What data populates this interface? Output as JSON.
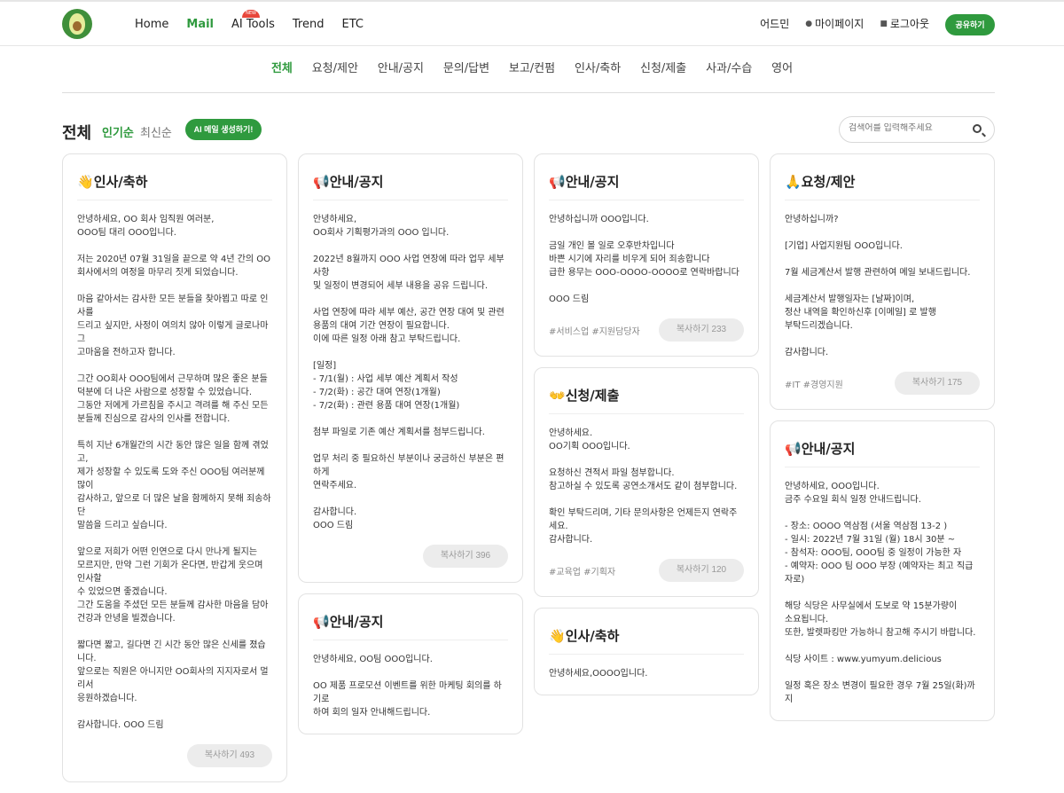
{
  "nav": {
    "items": [
      "Home",
      "Mail",
      "AI Tools",
      "Trend",
      "ETC"
    ],
    "active": "Mail",
    "badge": "NEW"
  },
  "user_nav": {
    "admin": "어드민",
    "mypage": "마이페이지",
    "logout": "로그아웃",
    "share": "공유하기"
  },
  "categories": [
    "전체",
    "요청/제안",
    "안내/공지",
    "문의/답변",
    "보고/컨펌",
    "인사/축하",
    "신청/제출",
    "사과/수습",
    "영어"
  ],
  "page": {
    "title": "전체",
    "sort_popular": "인기순",
    "sort_recent": "최신순",
    "ai_button": "AI 메일 생성하기!",
    "search_placeholder": "검색어를 입력해주세요"
  },
  "columns": [
    [
      {
        "emoji": "👋",
        "title": "인사/축하",
        "body": "안녕하세요, OO 회사 임직원 여러분,\nOOO팀 대리 OOO입니다.\n\n저는 2020년 07월 31일을 끝으로 약 4년 간의 OO\n회사에서의 여정을 마무리 짓게 되었습니다.\n\n마음 같아서는 감사한 모든 분들을 찾아뵙고 따로 인사를\n드리고 싶지만, 사정이 여의치 않아 이렇게 글로나마 그\n고마움을 전하고자 합니다.\n\n그간 OO회사 OOO팀에서 근무하며 많은 좋은 분들\n덕분에 더 나은 사람으로 성장할 수 있었습니다.\n그동안 저에게 가르침을 주시고 격려를 해 주신 모든\n분들께 진심으로 감사의 인사를 전합니다.\n\n특히 지난 6개월간의 시간 동안 많은 일을 함께 겪었고,\n제가 성장할 수 있도록 도와 주신 OOO팀 여러분께 많이\n감사하고, 앞으로 더 많은 날을 함께하지 못해 죄송하단\n말씀을 드리고 싶습니다.\n\n앞으로 저희가 어떤 인연으로 다시 만나게 될지는\n모르지만, 만약 그런 기회가 온다면, 반갑게 웃으며 인사할\n수 있었으면 좋겠습니다.\n그간 도움을 주셨던 모든 분들께 감사한 마음을 담아\n건강과 안녕을 빌겠습니다.\n\n짧다면 짧고, 길다면 긴 시간 동안 많은 신세를 졌습니다.\n앞으로는 직원은 아니지만 OO회사의 지지자로서 멀리서\n응원하겠습니다.\n\n감사합니다. OOO 드림",
        "tags": "",
        "copy": "복사하기 493"
      }
    ],
    [
      {
        "emoji": "📢",
        "title": "안내/공지",
        "body": "안녕하세요,\nOO회사 기획평가과의 OOO 입니다.\n\n2022년 8월까지 OOO 사업 연장에 따라 업무 세부 사항\n및 일정이 변경되어 세부 내용을 공유 드립니다.\n\n사업 연장에 따라 세부 예산, 공간 연장 대여 및 관련\n용품의 대여 기간 연장이 필요합니다.\n이에 따른 일정 아래 참고 부탁드립니다.\n\n[일정]\n- 7/1(월) : 사업 세부 예산 계획서 작성\n- 7/2(화) : 공간 대여 연장(1개월)\n- 7/2(화) : 관련 용품 대여 연장(1개월)\n\n첨부 파일로 기존 예산 계획서를 첨부드립니다.\n\n업무 처리 중 필요하신 부분이나 궁금하신 부분은 편하게\n연락주세요.\n\n감사합니다.\nOOO 드림",
        "tags": "",
        "copy": "복사하기 396"
      },
      {
        "emoji": "📢",
        "title": "안내/공지",
        "body": "안녕하세요, OO팀 OOO입니다.\n\nOO 제품 프로모션 이벤트를 위한 마케팅 회의를 하기로\n하여 회의 일자 안내해드립니다.",
        "tags": "",
        "copy": ""
      }
    ],
    [
      {
        "emoji": "📢",
        "title": "안내/공지",
        "body": "안녕하십니까 OOO입니다.\n\n금일 개인 볼 일로 오후반차입니다\n바쁜 시기에 자리를 비우게 되어 죄송합니다\n급한 용무는 OOO-OOOO-OOOO로 연락바랍니다\n\nOOO 드림",
        "tags": "#서비스업  #지원담당자",
        "copy": "복사하기 233"
      },
      {
        "emoji": "👐",
        "title": "신청/제출",
        "body": "안녕하세요.\nOO기획 OOO입니다.\n\n요청하신 견적서 파일 첨부합니다.\n참고하실 수 있도록 공연소개서도 같이 첨부합니다.\n\n확인 부탁드리며, 기타 문의사항은 언제든지 연락주세요.\n감사합니다.",
        "tags": "#교육업  #기획자",
        "copy": "복사하기 120"
      },
      {
        "emoji": "👋",
        "title": "인사/축하",
        "body": "안녕하세요,OOOO입니다.",
        "tags": "",
        "copy": ""
      }
    ],
    [
      {
        "emoji": "🙏",
        "title": "요청/제안",
        "body": "안녕하십니까?\n\n[기업] 사업지원팀 OOO입니다.\n\n7월 세금계산서 발행 관련하여 메일 보내드립니다.\n\n세금계산서 발행일자는 [날짜]이며,\n정산 내역을 확인하신후 [이메일] 로 발행\n부탁드리겠습니다.\n\n감사합니다.",
        "tags": "#IT  #경영지원",
        "copy": "복사하기 175"
      },
      {
        "emoji": "📢",
        "title": "안내/공지",
        "body": "안녕하세요, OOO입니다.\n금주 수요일 회식 일정 안내드립니다.\n\n- 장소: OOOO 역삼점 (서울 역삼점 13-2 )\n- 일시: 2022년 7월 31일 (월) 18시 30분 ~\n- 참석자: OOO팀, OOO팀 중 일정이 가능한 자\n- 예약자: OOO 팀 OOO 부장 (예약자는 최고 직급자로)\n\n해당 식당은 사무실에서 도보로 약 15분가량이\n소요됩니다.\n또한, 발렛파킹만 가능하니 참고해 주시기 바랍니다.\n\n식당 사이트 : www.yumyum.delicious\n\n일정 혹은 장소 변경이 필요한 경우 7월 25일(화)까지",
        "tags": "",
        "copy": ""
      }
    ]
  ],
  "colors": {
    "accent": "#2f9a3e",
    "copy_button_bg": "#ececec",
    "border": "#e2e2e2"
  }
}
